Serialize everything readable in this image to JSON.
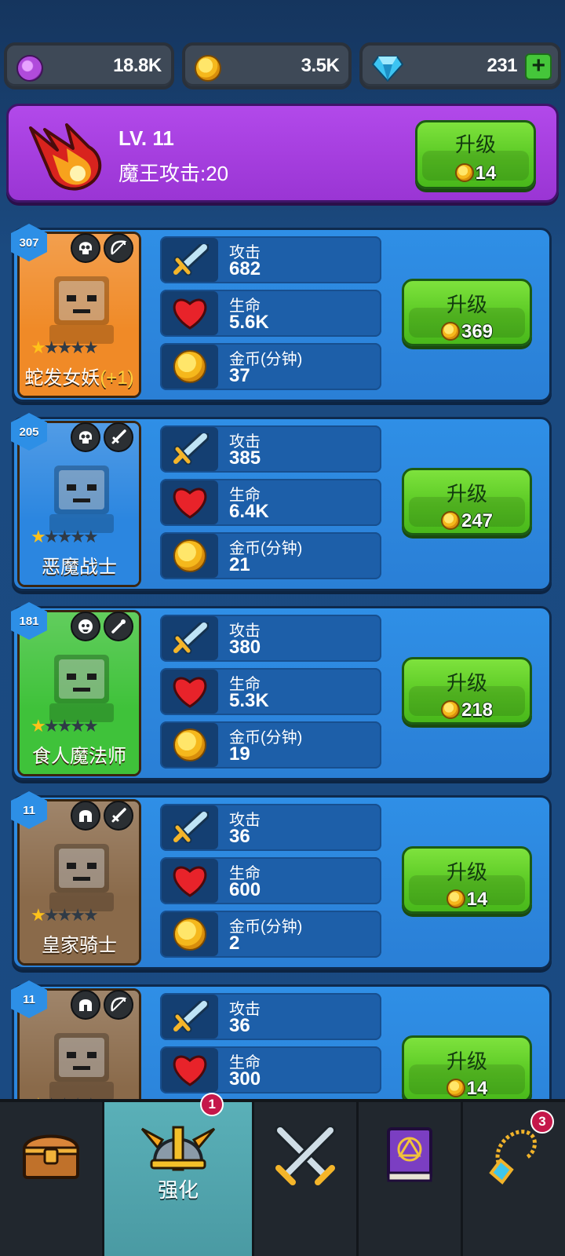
{
  "currencies": {
    "orb": {
      "value": "18.8K",
      "icon": "purple-orb-icon"
    },
    "gold": {
      "value": "3.5K",
      "icon": "gold-coin-icon"
    },
    "gem": {
      "value": "231",
      "icon": "diamond-icon",
      "add_label": "+"
    }
  },
  "boss": {
    "level": "LV. 11",
    "attack_label": "魔王攻击:20",
    "upgrade": {
      "label": "升级",
      "cost": "14"
    }
  },
  "stat_labels": {
    "attack": "攻击",
    "hp": "生命",
    "gold": "金币(分钟)"
  },
  "heroes": [
    {
      "power": "307",
      "name": "蛇发女妖",
      "bonus": "(+1)",
      "stars_filled": 1,
      "stars_total": 5,
      "tags": [
        "skull-icon",
        "bow-icon"
      ],
      "attack": "682",
      "hp": "5.6K",
      "gold": "37",
      "upgrade": {
        "label": "升级",
        "cost": "369"
      },
      "card_color": "#f08a27"
    },
    {
      "power": "205",
      "name": "恶魔战士",
      "stars_filled": 1,
      "stars_total": 5,
      "tags": [
        "skull-icon",
        "sword-icon"
      ],
      "attack": "385",
      "hp": "6.4K",
      "gold": "21",
      "upgrade": {
        "label": "升级",
        "cost": "247"
      },
      "card_color": "#2b86e0"
    },
    {
      "power": "181",
      "name": "食人魔法师",
      "stars_filled": 1,
      "stars_total": 5,
      "tags": [
        "orc-icon",
        "wand-icon"
      ],
      "attack": "380",
      "hp": "5.3K",
      "gold": "19",
      "upgrade": {
        "label": "升级",
        "cost": "218"
      },
      "card_color": "#3fc23a"
    },
    {
      "power": "11",
      "name": "皇家骑士",
      "stars_filled": 1,
      "stars_total": 5,
      "tags": [
        "helmet-icon",
        "sword-icon"
      ],
      "attack": "36",
      "hp": "600",
      "gold": "2",
      "upgrade": {
        "label": "升级",
        "cost": "14"
      },
      "card_color": "#8a6a4a"
    },
    {
      "power": "11",
      "name": "",
      "stars_filled": 1,
      "stars_total": 5,
      "tags": [
        "helmet-icon",
        "bow-icon"
      ],
      "attack": "36",
      "hp": "300",
      "upgrade": {
        "label": "升级",
        "cost": "14"
      },
      "card_color": "#8a6a4a"
    }
  ],
  "nav": {
    "tabs": [
      {
        "icon": "treasure-chest-icon",
        "label": ""
      },
      {
        "icon": "viking-helmet-icon",
        "label": "强化",
        "badge": "1",
        "active": true
      },
      {
        "icon": "crossed-swords-icon",
        "label": ""
      },
      {
        "icon": "spell-book-icon",
        "label": ""
      },
      {
        "icon": "amulet-icon",
        "label": "",
        "badge": "3"
      }
    ]
  }
}
